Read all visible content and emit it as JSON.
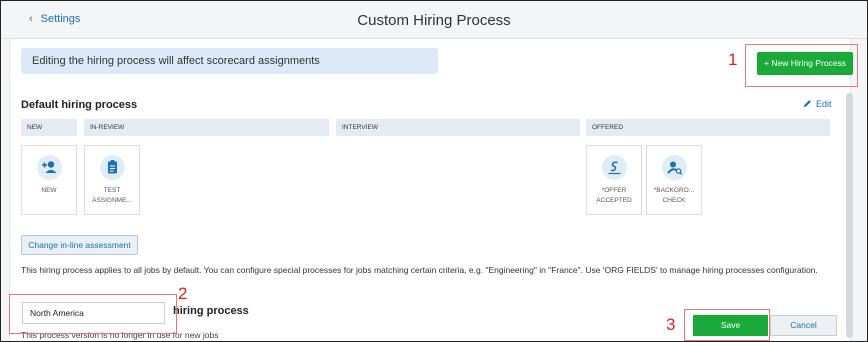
{
  "header": {
    "back_label": "Settings",
    "title": "Custom Hiring Process"
  },
  "banner": {
    "text": "Editing the hiring process will affect scorecard assignments"
  },
  "new_process_button": "+ New Hiring Process",
  "callouts": [
    "1",
    "2",
    "3"
  ],
  "default_process": {
    "title": "Default hiring process",
    "edit_label": "Edit",
    "stages": [
      "NEW",
      "IN-REVIEW",
      "INTERVIEW",
      "OFFERED"
    ],
    "cards": [
      {
        "icon": "add-person-icon",
        "lines": [
          "NEW"
        ]
      },
      {
        "icon": "clipboard-icon",
        "lines": [
          "TEST",
          "ASSIGNME..."
        ]
      },
      {
        "icon": "signature-icon",
        "lines": [
          "*OFFER",
          "ACCEPTED"
        ]
      },
      {
        "icon": "person-search-icon",
        "lines": [
          "*BACKGRO...",
          "CHECK"
        ]
      }
    ],
    "assessment_button": "Change in-line assessment",
    "info_text": "This hiring process applies to all jobs by default. You can configure special processes for jobs matching certain criteria, e.g. \"Engineering\" in \"France\". Use 'ORG FIELDS' to manage hiring processes configuration."
  },
  "region_field": {
    "value": "North America"
  },
  "second_process": {
    "title_fragment": "hiring process",
    "note": "This process version is no longer in use for new jobs"
  },
  "actions": {
    "save": "Save",
    "cancel": "Cancel"
  },
  "colors": {
    "accent": "#1aaa3a",
    "link": "#1f6fb2",
    "callout": "#dd2222"
  }
}
